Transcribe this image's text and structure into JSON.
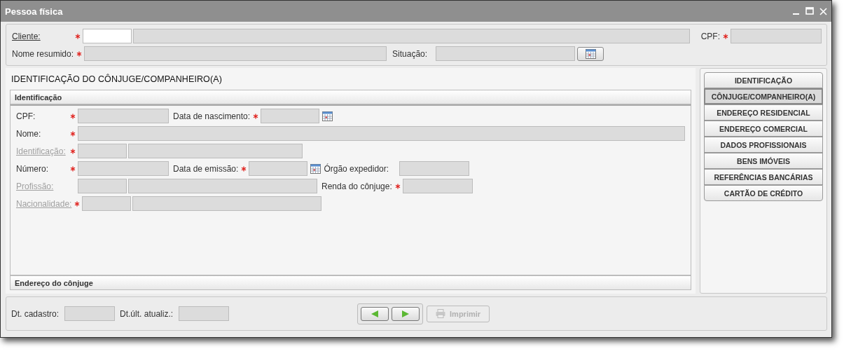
{
  "window": {
    "title": "Pessoa física"
  },
  "header": {
    "fields": [
      {
        "label": "Cliente:",
        "link": true,
        "disabled": false,
        "required": true,
        "enabled": true
      },
      {
        "label": "CPF:",
        "link": false,
        "disabled": false,
        "required": true,
        "enabled": false
      },
      {
        "label": "Nome resumido:",
        "link": false,
        "disabled": false,
        "required": true,
        "enabled": false
      },
      {
        "label": "Situação:",
        "link": false,
        "disabled": false,
        "required": false,
        "enabled": false
      }
    ]
  },
  "page_title": "IDENTIFICAÇÃO DO CÔNJUGE/COMPANHEIRO(A)",
  "sections": [
    {
      "title": "Identificação",
      "fields": [
        {
          "label": "CPF:",
          "link": false,
          "disabled": false,
          "required": true
        },
        {
          "label": "Data de nascimento:",
          "link": false,
          "disabled": false,
          "required": true
        },
        {
          "label": "Nome:",
          "link": false,
          "disabled": false,
          "required": true
        },
        {
          "label": "Identificação:",
          "link": true,
          "disabled": true,
          "required": true
        },
        {
          "label": "Número:",
          "link": false,
          "disabled": false,
          "required": true
        },
        {
          "label": "Data de emissão:",
          "link": false,
          "disabled": false,
          "required": true
        },
        {
          "label": "Órgão expedidor:",
          "link": false,
          "disabled": false,
          "required": false
        },
        {
          "label": "Profissão:",
          "link": true,
          "disabled": true,
          "required": false
        },
        {
          "label": "Renda do cônjuge:",
          "link": false,
          "disabled": false,
          "required": true
        },
        {
          "label": "Nacionalidade:",
          "link": true,
          "disabled": true,
          "required": true
        }
      ]
    },
    {
      "title": "Endereço do cônjuge"
    }
  ],
  "nav": [
    {
      "label": "IDENTIFICAÇÃO",
      "selected": false
    },
    {
      "label": "CÔNJUGE/COMPANHEIRO(A)",
      "selected": true
    },
    {
      "label": "ENDEREÇO RESIDENCIAL",
      "selected": false
    },
    {
      "label": "ENDEREÇO COMERCIAL",
      "selected": false
    },
    {
      "label": "DADOS PROFISSIONAIS",
      "selected": false
    },
    {
      "label": "BENS IMÓVEIS",
      "selected": false
    },
    {
      "label": "REFERÊNCIAS BANCÁRIAS",
      "selected": false
    },
    {
      "label": "CARTÃO DE CRÉDITO",
      "selected": false
    }
  ],
  "footer": {
    "fields": [
      {
        "label": "Dt. cadastro:"
      },
      {
        "label": "Dt.últ. atualiz.:"
      }
    ],
    "print_button": {
      "label": "Imprimir",
      "disabled": true
    }
  }
}
